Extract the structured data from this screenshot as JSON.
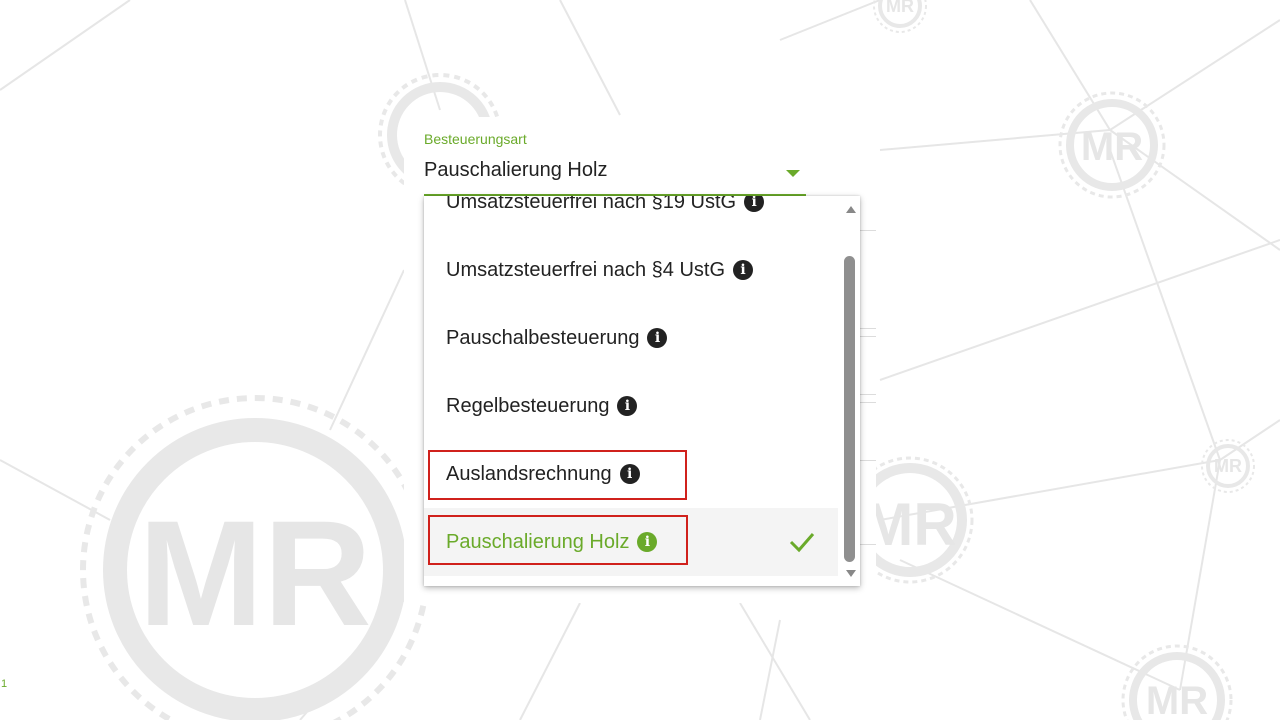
{
  "background": {
    "logo_text": "MR"
  },
  "field": {
    "label": "Besteuerungsart",
    "value": "Pauschalierung Holz"
  },
  "options": [
    {
      "label": "Umsatzsteuerfrei nach §19 UstG",
      "info": "i"
    },
    {
      "label": "Umsatzsteuerfrei nach §4 UstG",
      "info": "i"
    },
    {
      "label": "Pauschalbesteuerung",
      "info": "i"
    },
    {
      "label": "Regelbesteuerung",
      "info": "i"
    },
    {
      "label": "Auslandsrechnung",
      "info": "i",
      "highlighted": true
    },
    {
      "label": "Pauschalierung Holz",
      "info": "i",
      "highlighted": true,
      "selected": true
    }
  ],
  "slide_number": "1",
  "colors": {
    "accent": "#6aaa2a",
    "highlight": "#d0211c",
    "text": "#222222"
  },
  "icons": [
    "chevron-down-icon",
    "info-icon",
    "check-icon",
    "scroll-up-icon",
    "scroll-down-icon"
  ]
}
